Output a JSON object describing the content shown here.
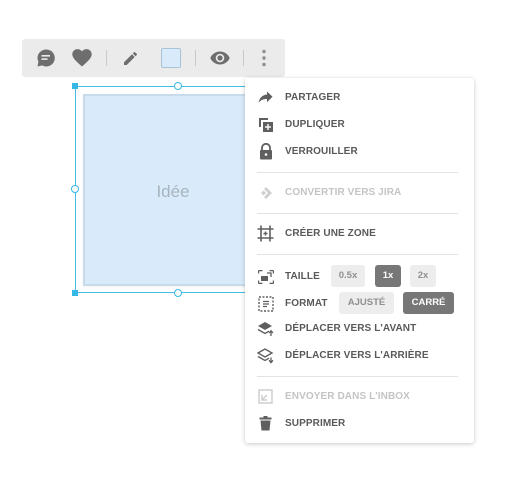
{
  "toolbar": {
    "items": [
      "comment-icon",
      "heart-icon",
      "pencil-icon",
      "color-swatch",
      "eye-icon",
      "more-vertical-icon"
    ],
    "swatch_color": "#d9ebfb"
  },
  "card": {
    "text": "Idée",
    "color": "#d9ebfb"
  },
  "menu": {
    "share": "PARTAGER",
    "duplicate": "DUPLIQUER",
    "lock": "VERROUILLER",
    "jira": "CONVERTIR VERS JIRA",
    "zone": "CRÉER UNE ZONE",
    "size": {
      "label": "TAILLE",
      "options": [
        "0.5x",
        "1x",
        "2x"
      ],
      "selected": "1x"
    },
    "format": {
      "label": "FORMAT",
      "options": [
        "AJUSTÉ",
        "CARRÉ"
      ],
      "selected": "CARRÉ"
    },
    "front": "DÉPLACER VERS L'AVANT",
    "back": "DÉPLACER VERS L'ARRIÈRE",
    "inbox": "ENVOYER DANS L'INBOX",
    "delete": "SUPPRIMER"
  }
}
